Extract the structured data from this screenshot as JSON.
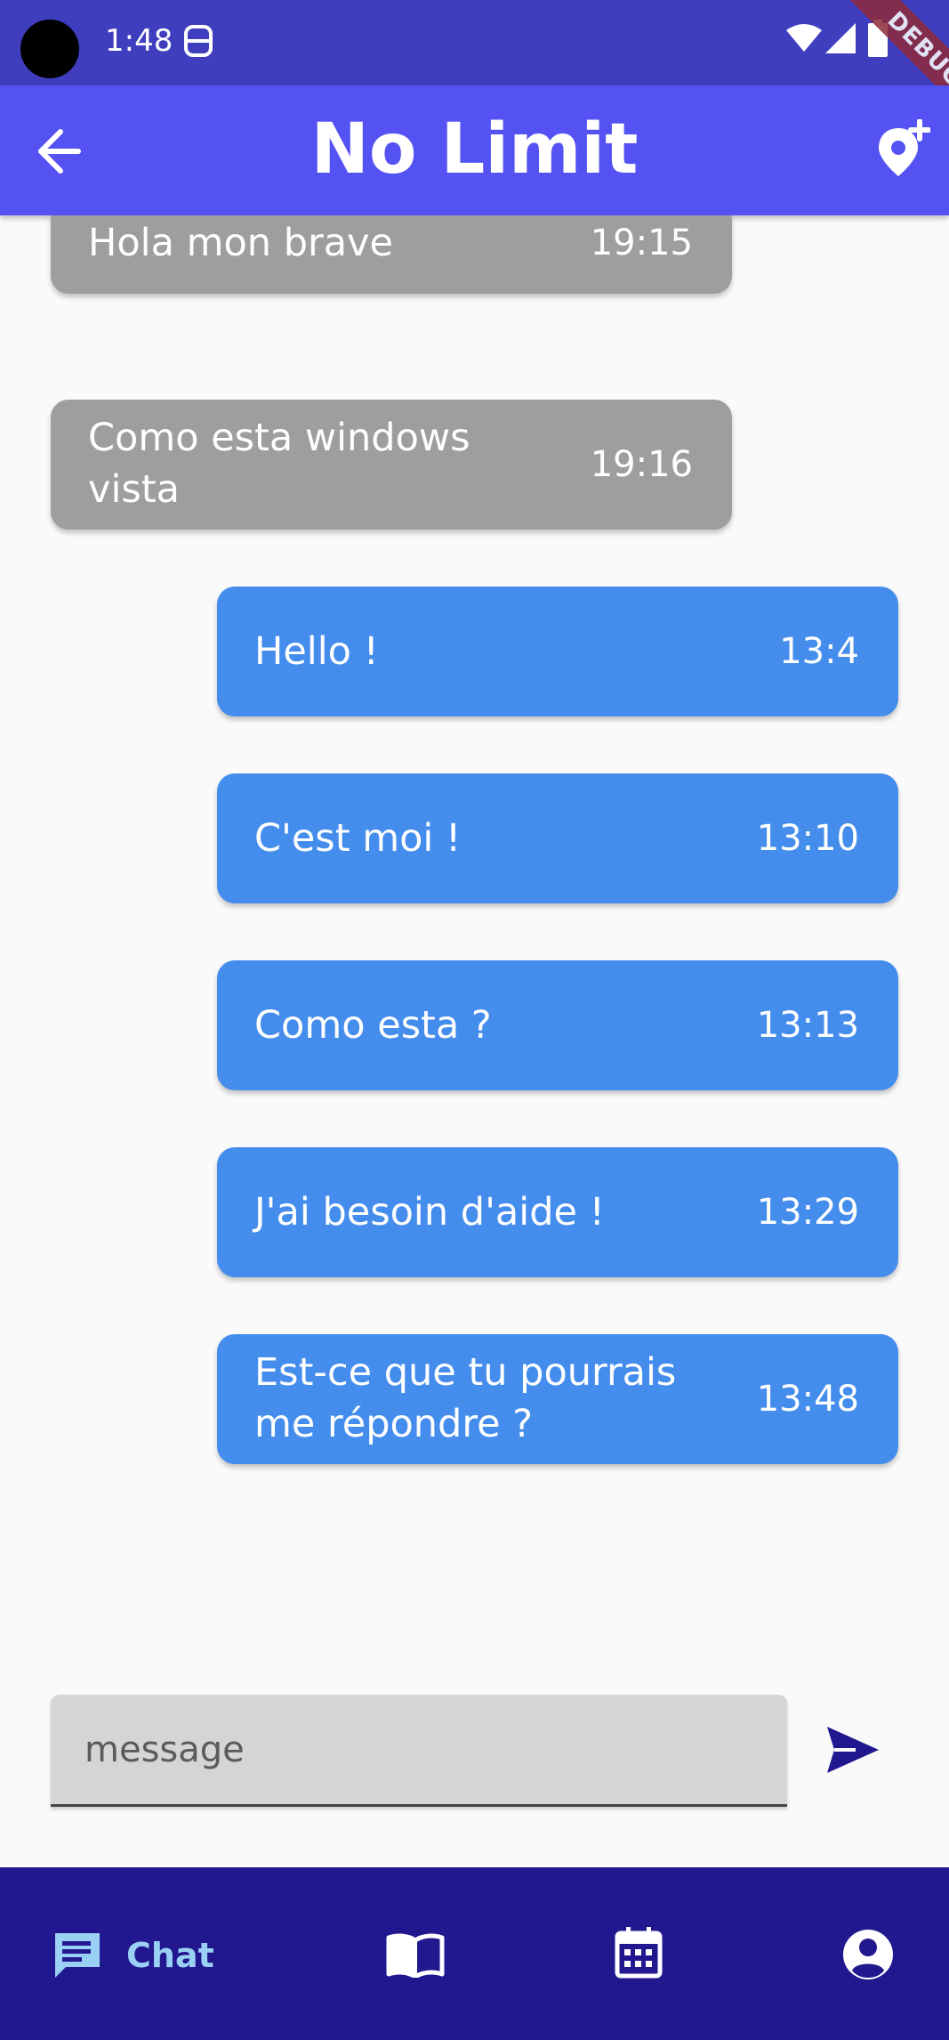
{
  "status_bar": {
    "time": "1:48",
    "debug_banner": "DEBUG",
    "icons": [
      "camera-cutout",
      "notification-icon",
      "wifi-icon",
      "signal-icon",
      "battery-icon"
    ]
  },
  "app_bar": {
    "title": "No Limit",
    "left_icon": "back-arrow-icon",
    "right_icon": "add-location-icon"
  },
  "messages": [
    {
      "text": "Hola mon brave",
      "time": "19:15",
      "direction": "received"
    },
    {
      "text": "Como esta windows vista",
      "time": "19:16",
      "direction": "received"
    },
    {
      "text": "Hello !",
      "time": "13:4",
      "direction": "sent"
    },
    {
      "text": "C'est moi !",
      "time": "13:10",
      "direction": "sent"
    },
    {
      "text": "Como esta ?",
      "time": "13:13",
      "direction": "sent"
    },
    {
      "text": "J'ai besoin d'aide !",
      "time": "13:29",
      "direction": "sent"
    },
    {
      "text": "Est-ce que tu pourrais me répondre ?",
      "time": "13:48",
      "direction": "sent"
    }
  ],
  "composer": {
    "placeholder": "message",
    "value": "",
    "send_icon": "send-icon"
  },
  "bottom_nav": {
    "items": [
      {
        "label": "Chat",
        "icon": "chat-icon",
        "active": true
      },
      {
        "label": "",
        "icon": "book-icon",
        "active": false
      },
      {
        "label": "",
        "icon": "calendar-icon",
        "active": false
      },
      {
        "label": "",
        "icon": "profile-icon",
        "active": false
      }
    ]
  },
  "colors": {
    "status_bar": "#3f3ebf",
    "app_bar": "#5552f3",
    "received_bubble": "#9e9e9e",
    "sent_bubble": "#448ded",
    "bottom_nav": "#21188f",
    "active_nav": "#9bd0f5",
    "send_icon": "#21188f"
  }
}
